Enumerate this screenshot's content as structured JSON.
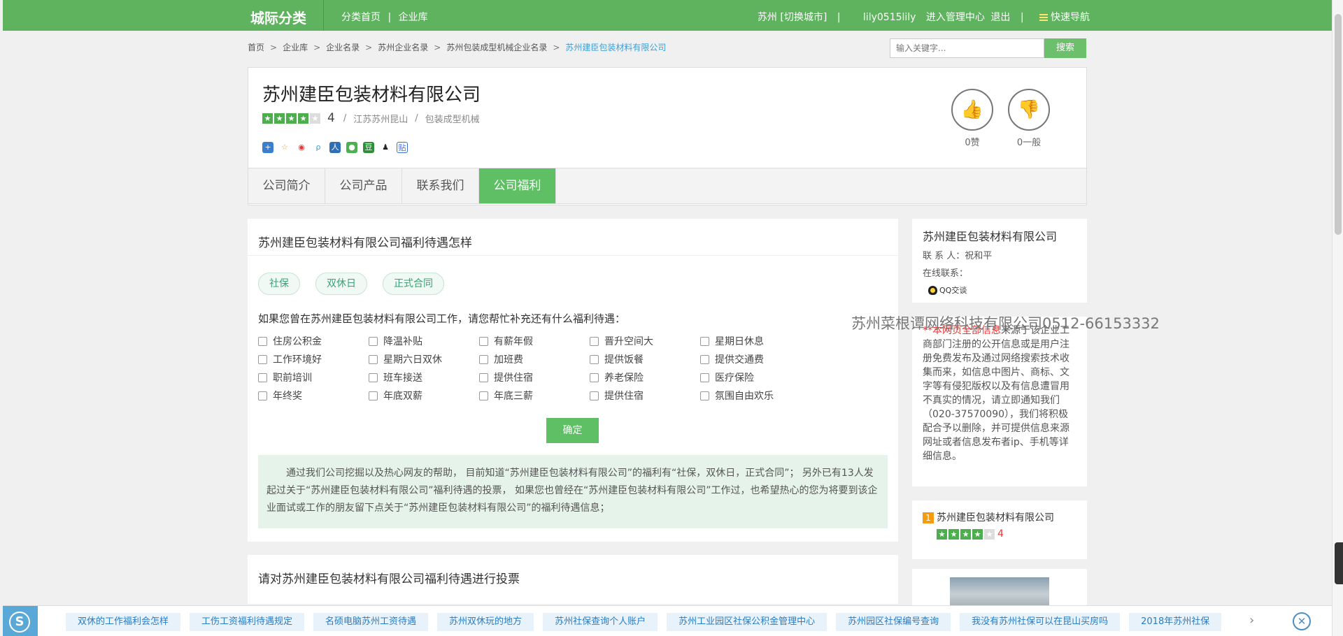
{
  "header": {
    "logo": "城际分类",
    "nav": [
      "分类首页",
      "|",
      "企业库"
    ],
    "city": "苏州 [切换城市]",
    "divider": "|",
    "username": "lily0515lily",
    "admin": "进入管理中心",
    "logout": "退出",
    "quick_nav": "快速导航"
  },
  "breadcrumb": {
    "items": [
      "首页",
      "企业库",
      "企业名录",
      "苏州企业名录",
      "苏州包装成型机械企业名录"
    ],
    "current": "苏州建臣包装材料有限公司",
    "separator": ">"
  },
  "search": {
    "placeholder": "输入关键字...",
    "button": "搜索"
  },
  "company": {
    "name": "苏州建臣包装材料有限公司",
    "rating_value": 4,
    "rating_max": 5,
    "rating_text": "4",
    "location": "江苏苏州昆山",
    "category": "包装成型机械",
    "slash": "/",
    "share_icons": [
      "qzone-icon",
      "favorite-icon",
      "weibo-icon",
      "pengyou-icon",
      "renren-icon",
      "wechat-icon",
      "douban-icon",
      "qq-icon",
      "tieba-icon"
    ],
    "like_label": "0赞",
    "normal_label": "0一般"
  },
  "tabs": [
    "公司简介",
    "公司产品",
    "联系我们",
    "公司福利"
  ],
  "active_tab": 3,
  "welfare": {
    "title": "苏州建臣包装材料有限公司福利待遇怎样",
    "tags": [
      "社保",
      "双休日",
      "正式合同"
    ],
    "question": "如果您曾在苏州建臣包装材料有限公司工作，请您帮忙补充还有什么福利待遇：",
    "options": [
      "住房公积金",
      "降温补贴",
      "有薪年假",
      "晋升空间大",
      "星期日休息",
      "工作环境好",
      "星期六日双休",
      "加班费",
      "提供饭餐",
      "提供交通费",
      "职前培训",
      "班车接送",
      "提供住宿",
      "养老保险",
      "医疗保险",
      "年终奖",
      "年底双薪",
      "年底三薪",
      "提供住宿",
      "氛围自由欢乐"
    ],
    "confirm": "确定",
    "info": "通过我们公司挖掘以及热心网友的帮助， 目前知道“苏州建臣包装材料有限公司”的福利有“社保，双休日，正式合同”； 另外已有13人发起过关于“苏州建臣包装材料有限公司”福利待遇的投票， 如果您也曾经在“苏州建臣包装材料有限公司”工作过，也希望热心的您为将要到该企业面试或工作的朋友留下点关于“苏州建臣包装材料有限公司”的福利待遇信息；"
  },
  "vote_section": {
    "title": "请对苏州建臣包装材料有限公司福利待遇进行投票"
  },
  "sidebar": {
    "company": "苏州建臣包装材料有限公司",
    "contact": "联 系 人：祝和平",
    "online": "在线联系：",
    "qq": "QQ交谈",
    "watermark": "苏州菜根谭网络科技有限公司0512-66153332",
    "disclaimer_red": "**本网页全部信息",
    "disclaimer": "来源于该企业工商部门注册的公开信息或是用户注册免费发布及通过网络搜索技术收集而来，如信息中图片、商标、文字等有侵犯版权以及有信息遭冒用不真实的情况，请立即通知我们（020-37570090），我们将积极配合予以删除，并可提供信息来源网址或者信息发布者ip、手机等详细信息。",
    "rank_no": "1",
    "rank_name": "苏州建臣包装材料有限公司",
    "rank_rating": 4,
    "rank_rating_text": "4"
  },
  "bottom_links": [
    "双休的工作福利会怎样",
    "工伤工资福利待遇规定",
    "名硕电脑苏州工资待遇",
    "苏州双休玩的地方",
    "苏州社保查询个人账户",
    "苏州工业园区社保公积金管理中心",
    "苏州园区社保编号查询",
    "我没有苏州社保可以在昆山买房吗",
    "2018年苏州社保"
  ],
  "colors": {
    "brand_green": "#5fb35f",
    "tab_active": "#5fbf65",
    "link_blue": "#3aa0d8",
    "bottom_blue": "#5aa8d8"
  }
}
